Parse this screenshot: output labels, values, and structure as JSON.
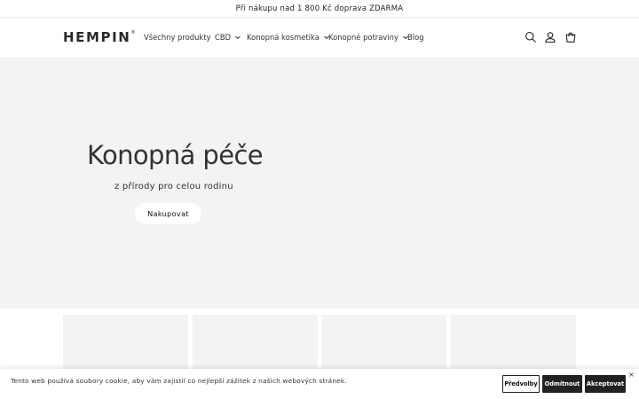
{
  "announcement": {
    "text": "Při nákupu nad 1 800 Kč doprava ZDARMA"
  },
  "header": {
    "logo": "HEMPIN",
    "logo_mark": "®",
    "nav": [
      {
        "label": "Všechny produkty",
        "has_dropdown": false
      },
      {
        "label": "CBD",
        "has_dropdown": true
      },
      {
        "label": "Konopná kosmetika",
        "has_dropdown": true
      },
      {
        "label": "Konopné potraviny",
        "has_dropdown": true
      },
      {
        "label": "Blog",
        "has_dropdown": false
      }
    ],
    "icons": [
      "search-icon",
      "account-icon",
      "cart-icon"
    ]
  },
  "hero": {
    "title": "Konopná péče",
    "subtitle": "z přírody pro celou rodinu",
    "button": "Nakupovat",
    "background": "#f3f3f3"
  },
  "cookie_banner": {
    "text": "Tento web používá soubory cookie, aby vám zajistil co nejlepší zážitek z našich webových stránek.",
    "buttons": {
      "preferences": "Předvolby",
      "decline": "Odmítnout",
      "accept": "Akceptovat"
    },
    "close": "×"
  }
}
